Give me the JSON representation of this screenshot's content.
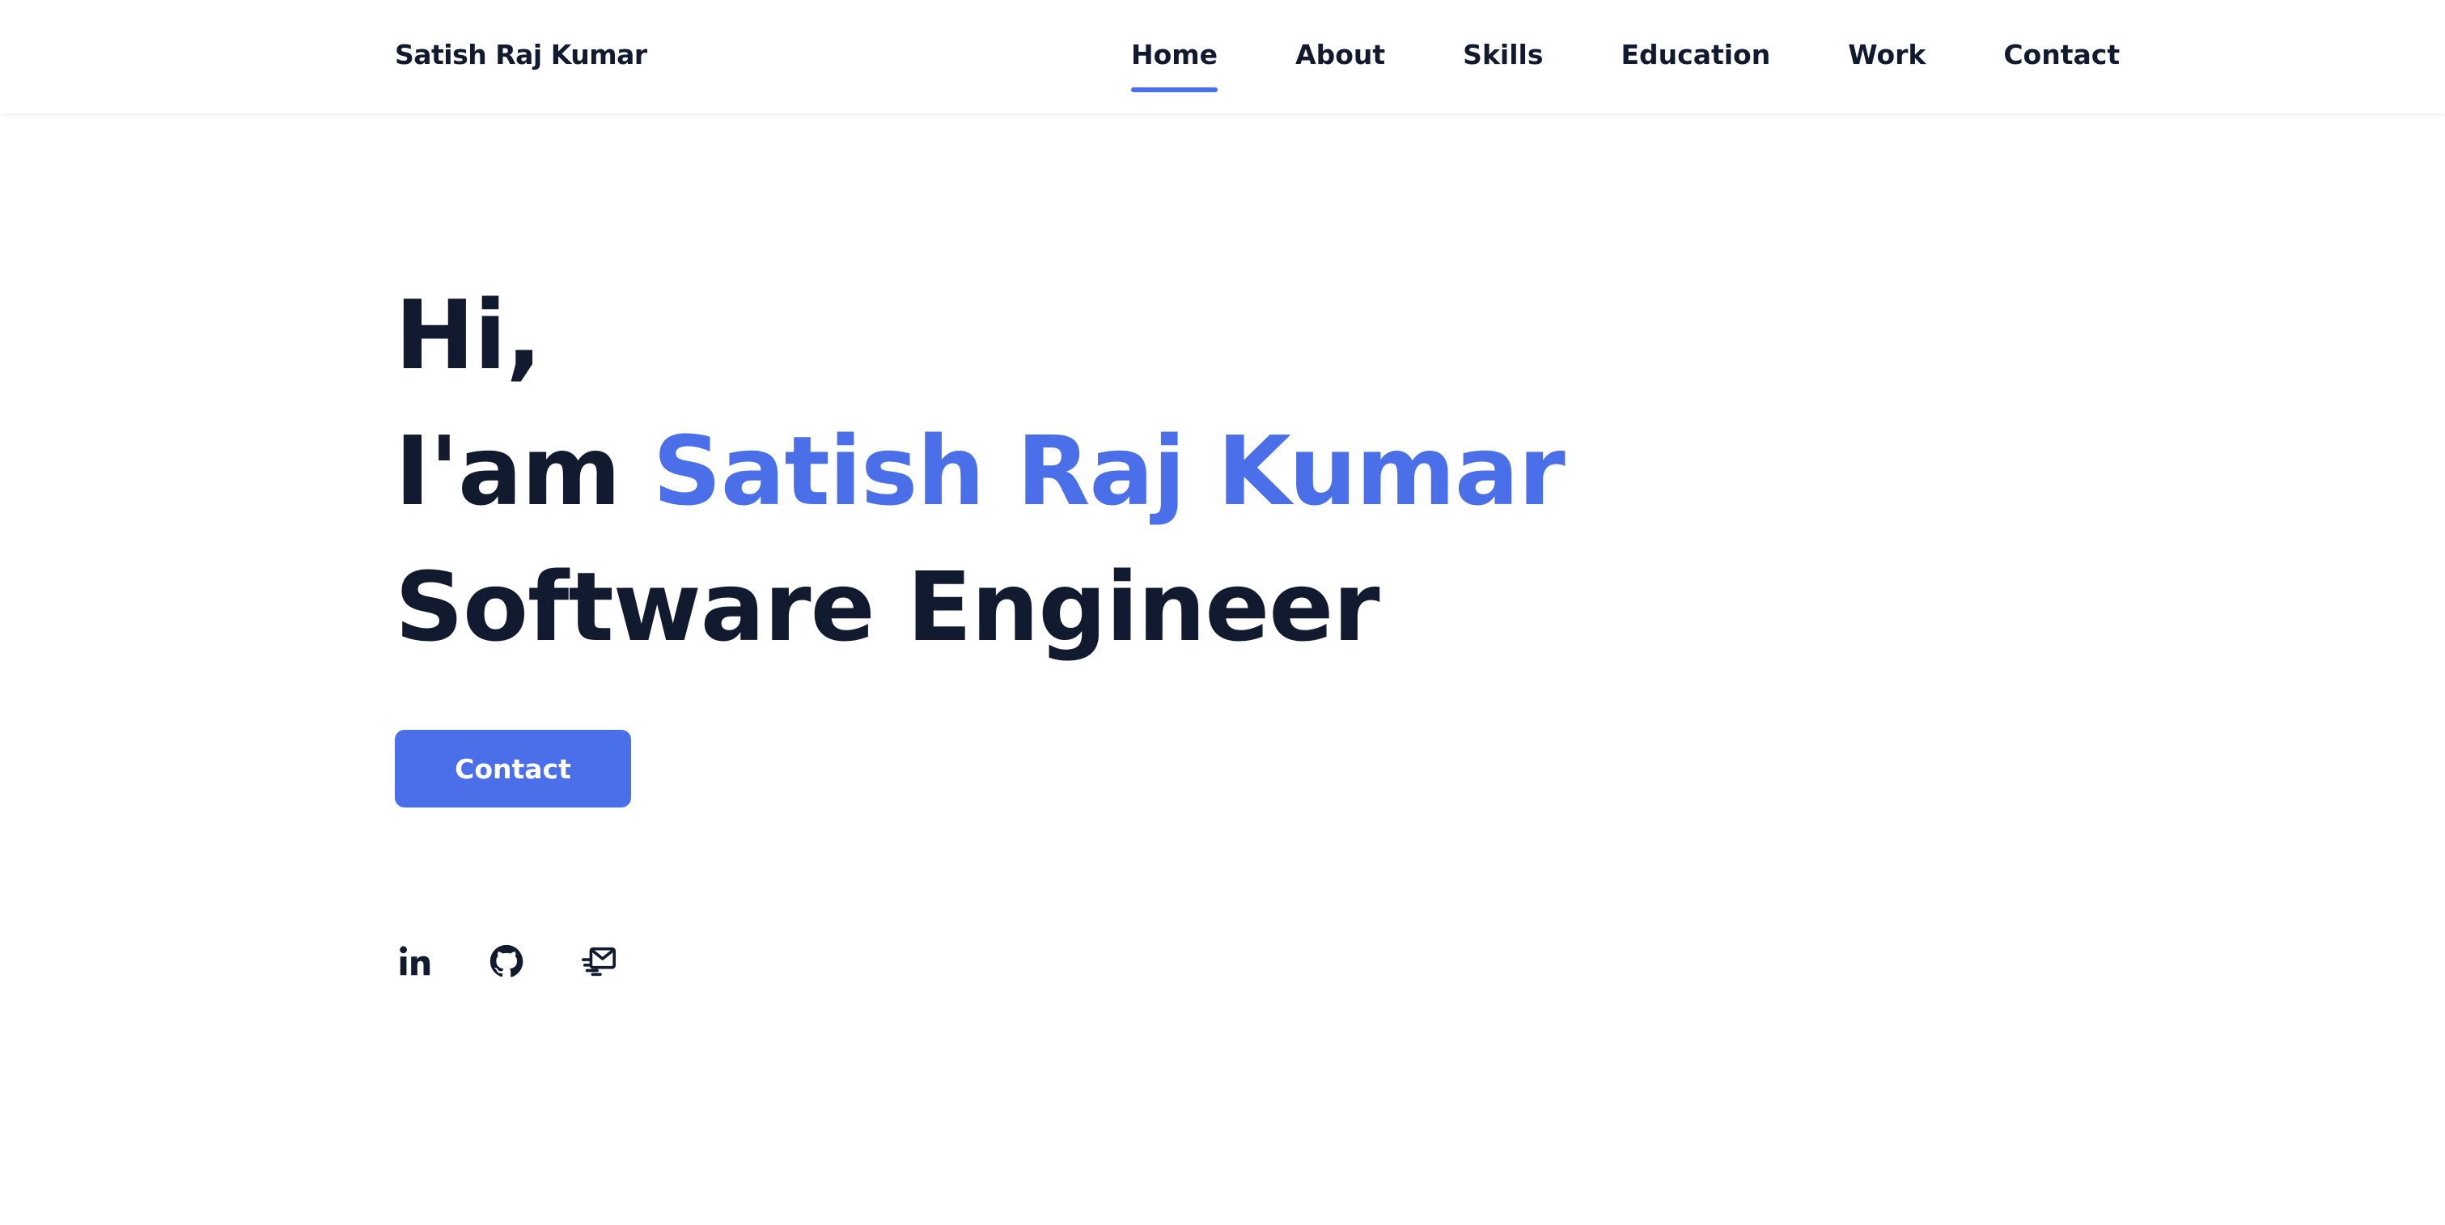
{
  "header": {
    "logo": "Satish Raj Kumar",
    "nav": [
      {
        "label": "Home",
        "active": true
      },
      {
        "label": "About"
      },
      {
        "label": "Skills"
      },
      {
        "label": "Education"
      },
      {
        "label": "Work"
      },
      {
        "label": "Contact"
      }
    ]
  },
  "hero": {
    "greeting": "Hi,",
    "intro_prefix": "I'am",
    "name": "Satish Raj Kumar",
    "role": "Software Engineer",
    "contact_label": "Contact"
  },
  "socials": [
    {
      "icon": "linkedin-icon"
    },
    {
      "icon": "github-icon"
    },
    {
      "icon": "mail-send-icon"
    }
  ],
  "colors": {
    "accent": "#4a6fe8",
    "text": "#121a2f",
    "background": "#ffffff"
  }
}
